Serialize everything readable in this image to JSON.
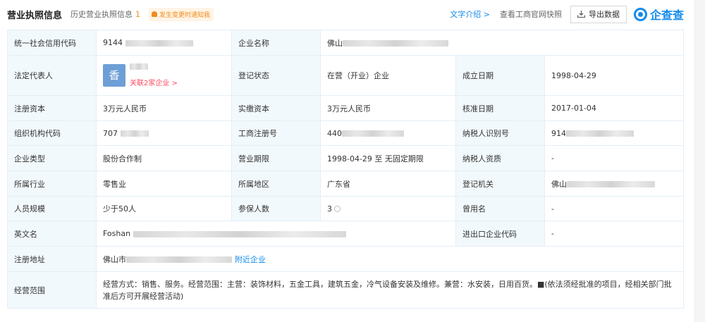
{
  "header": {
    "title": "营业执照信息",
    "history_label": "历史营业执照信息",
    "history_count": "1",
    "notify_label": "发生变更时通知我",
    "text_intro": "文字介绍 >",
    "check_official": "查看工商官网快照",
    "export_label": "导出数据",
    "logo_text": "企查查"
  },
  "labels": {
    "credit_code": "统一社会信用代码",
    "company_name": "企业名称",
    "legal_rep": "法定代表人",
    "reg_status": "登记状态",
    "established": "成立日期",
    "reg_capital": "注册资本",
    "paid_capital": "实缴资本",
    "approval_date": "核准日期",
    "org_code": "组织机构代码",
    "business_reg_no": "工商注册号",
    "taxpayer_id": "纳税人识别号",
    "company_type": "企业类型",
    "business_term": "营业期限",
    "taxpayer_qual": "纳税人资质",
    "industry": "所属行业",
    "region": "所属地区",
    "reg_authority": "登记机关",
    "staff_size": "人员规模",
    "insured_count": "参保人数",
    "former_name": "曾用名",
    "english_name": "英文名",
    "import_export_code": "进出口企业代码",
    "reg_address": "注册地址",
    "business_scope": "经营范围"
  },
  "values": {
    "credit_code": "9144",
    "company_name": "佛山",
    "legal_rep_avatar": "香",
    "legal_rep_link": "关联2家企业 >",
    "reg_status": "在营（开业）企业",
    "established": "1998-04-29",
    "reg_capital": "3万元人民币",
    "paid_capital": "3万元人民币",
    "approval_date": "2017-01-04",
    "org_code": "707",
    "business_reg_no": "440",
    "taxpayer_id": "914",
    "company_type": "股份合作制",
    "business_term": "1998-04-29 至 无固定期限",
    "taxpayer_qual": "-",
    "industry": "零售业",
    "region": "广东省",
    "reg_authority": "佛山",
    "staff_size": "少于50人",
    "insured_count": "3",
    "former_name": "-",
    "english_name": "Foshan",
    "import_export_code": "-",
    "reg_address": "佛山市",
    "nearby_link": "附近企业",
    "business_scope": "经营方式：销售、服务。经营范围：主营：装饰材料，五金工具，建筑五金，冷气设备安装及维修。兼营：水安装，日用百货。■(依法须经批准的项目，经相关部门批准后方可开展经营活动)"
  },
  "colors": {
    "accent_blue": "#128bed",
    "label_bg": "#f2f9fc",
    "border": "#e4eef6",
    "orange": "#f08c1b",
    "link_red": "#fd485e",
    "avatar_bg": "#6d9fd6"
  },
  "icons": {
    "export": "download-icon",
    "bell": "bell-icon",
    "logo": "qichacha-logo-icon",
    "info": "info-circle-icon"
  }
}
